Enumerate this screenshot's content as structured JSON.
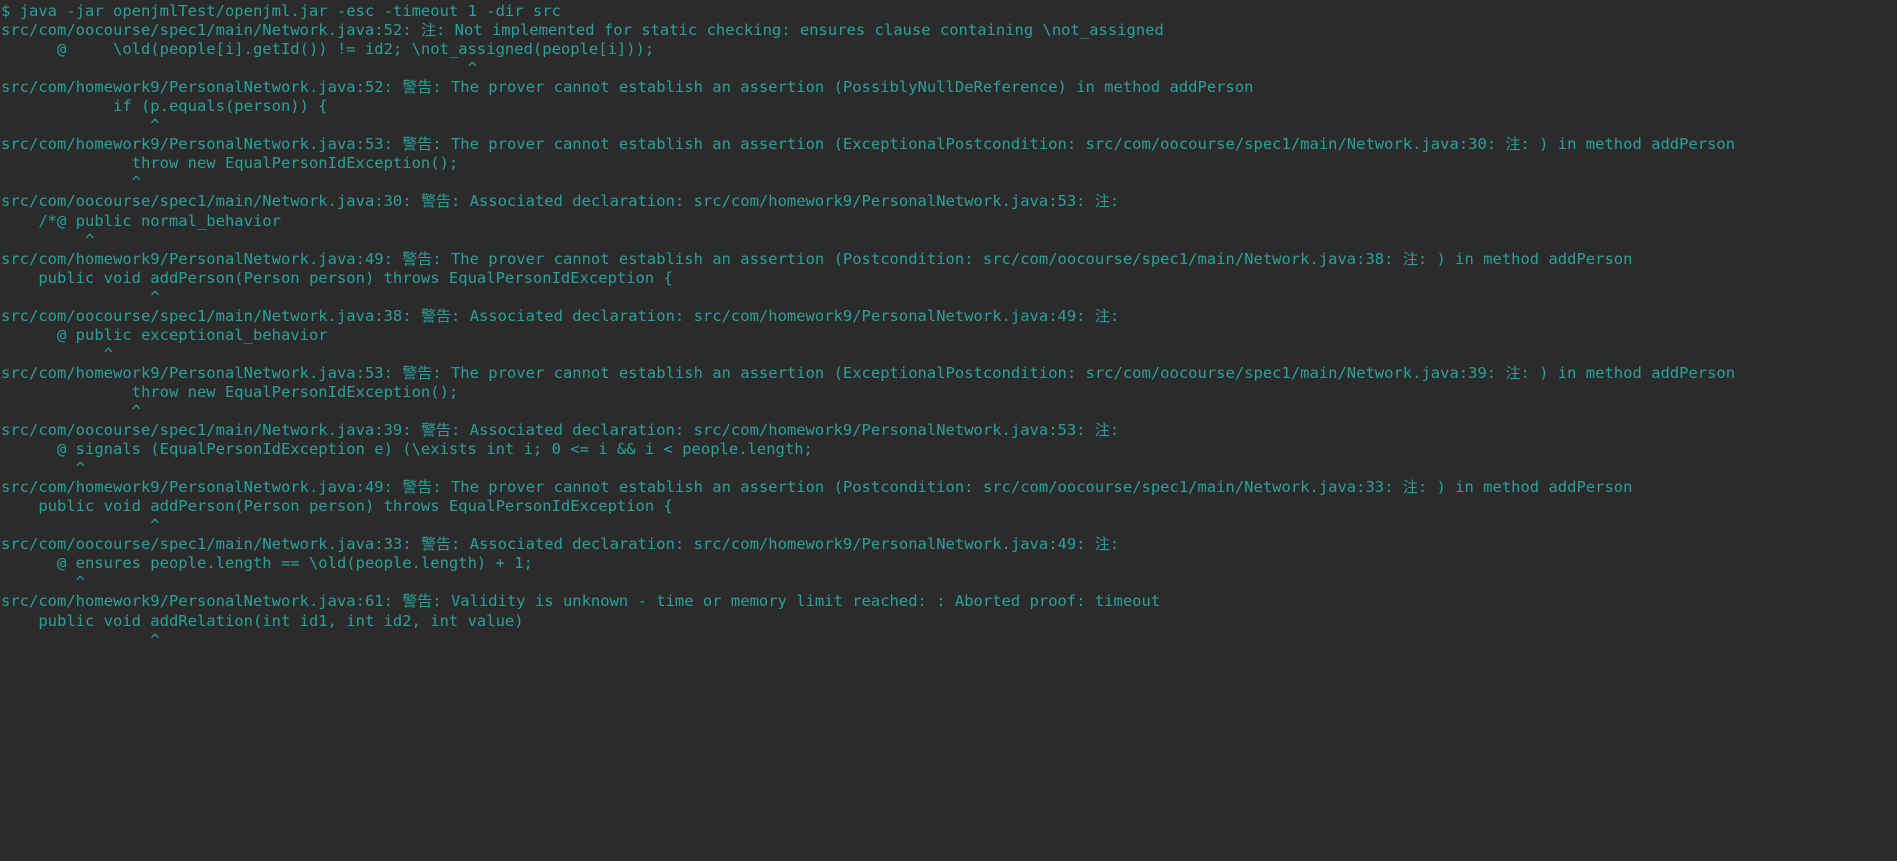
{
  "terminal": {
    "title": "Terminal",
    "colors": {
      "background": "#2b2b2b",
      "foreground": "#2aa198",
      "prompt": "#2aa198"
    },
    "prompt_symbol": "$",
    "command": "java -jar openjmlTest/openjml.jar -esc -timeout 1 -dir src",
    "lines": [
      {
        "id": "l0",
        "kind": "command",
        "text": "$ java -jar openjmlTest/openjml.jar -esc -timeout 1 -dir src"
      },
      {
        "id": "l1",
        "kind": "note",
        "text": "src/com/oocourse/spec1/main/Network.java:52: 注: Not implemented for static checking: ensures clause containing \\not_assigned"
      },
      {
        "id": "l2",
        "kind": "source",
        "text": "      @     \\old(people[i].getId()) != id2; \\not_assigned(people[i]));"
      },
      {
        "id": "l3",
        "kind": "caret",
        "text": "                                                  ^"
      },
      {
        "id": "l4",
        "kind": "warning",
        "text": "src/com/homework9/PersonalNetwork.java:52: 警告: The prover cannot establish an assertion (PossiblyNullDeReference) in method addPerson"
      },
      {
        "id": "l5",
        "kind": "source",
        "text": "            if (p.equals(person)) {"
      },
      {
        "id": "l6",
        "kind": "caret",
        "text": "                ^"
      },
      {
        "id": "l7",
        "kind": "warning",
        "text": "src/com/homework9/PersonalNetwork.java:53: 警告: The prover cannot establish an assertion (ExceptionalPostcondition: src/com/oocourse/spec1/main/Network.java:30: 注: ) in method addPerson"
      },
      {
        "id": "l8",
        "kind": "source",
        "text": "              throw new EqualPersonIdException();"
      },
      {
        "id": "l9",
        "kind": "caret",
        "text": "              ^"
      },
      {
        "id": "l10",
        "kind": "warning",
        "text": "src/com/oocourse/spec1/main/Network.java:30: 警告: Associated declaration: src/com/homework9/PersonalNetwork.java:53: 注: "
      },
      {
        "id": "l11",
        "kind": "source",
        "text": "    /*@ public normal_behavior"
      },
      {
        "id": "l12",
        "kind": "caret",
        "text": "         ^"
      },
      {
        "id": "l13",
        "kind": "warning",
        "text": "src/com/homework9/PersonalNetwork.java:49: 警告: The prover cannot establish an assertion (Postcondition: src/com/oocourse/spec1/main/Network.java:38: 注: ) in method addPerson"
      },
      {
        "id": "l14",
        "kind": "source",
        "text": "    public void addPerson(Person person) throws EqualPersonIdException {"
      },
      {
        "id": "l15",
        "kind": "caret",
        "text": "                ^"
      },
      {
        "id": "l16",
        "kind": "warning",
        "text": "src/com/oocourse/spec1/main/Network.java:38: 警告: Associated declaration: src/com/homework9/PersonalNetwork.java:49: 注: "
      },
      {
        "id": "l17",
        "kind": "source",
        "text": "      @ public exceptional_behavior"
      },
      {
        "id": "l18",
        "kind": "caret",
        "text": "           ^"
      },
      {
        "id": "l19",
        "kind": "warning",
        "text": "src/com/homework9/PersonalNetwork.java:53: 警告: The prover cannot establish an assertion (ExceptionalPostcondition: src/com/oocourse/spec1/main/Network.java:39: 注: ) in method addPerson"
      },
      {
        "id": "l20",
        "kind": "source",
        "text": "              throw new EqualPersonIdException();"
      },
      {
        "id": "l21",
        "kind": "caret",
        "text": "              ^"
      },
      {
        "id": "l22",
        "kind": "warning",
        "text": "src/com/oocourse/spec1/main/Network.java:39: 警告: Associated declaration: src/com/homework9/PersonalNetwork.java:53: 注: "
      },
      {
        "id": "l23",
        "kind": "source",
        "text": "      @ signals (EqualPersonIdException e) (\\exists int i; 0 <= i && i < people.length;"
      },
      {
        "id": "l24",
        "kind": "caret",
        "text": "        ^"
      },
      {
        "id": "l25",
        "kind": "warning",
        "text": "src/com/homework9/PersonalNetwork.java:49: 警告: The prover cannot establish an assertion (Postcondition: src/com/oocourse/spec1/main/Network.java:33: 注: ) in method addPerson"
      },
      {
        "id": "l26",
        "kind": "source",
        "text": "    public void addPerson(Person person) throws EqualPersonIdException {"
      },
      {
        "id": "l27",
        "kind": "caret",
        "text": "                ^"
      },
      {
        "id": "l28",
        "kind": "warning",
        "text": "src/com/oocourse/spec1/main/Network.java:33: 警告: Associated declaration: src/com/homework9/PersonalNetwork.java:49: 注: "
      },
      {
        "id": "l29",
        "kind": "source",
        "text": "      @ ensures people.length == \\old(people.length) + 1;"
      },
      {
        "id": "l30",
        "kind": "caret",
        "text": "        ^"
      },
      {
        "id": "l31",
        "kind": "warning",
        "text": "src/com/homework9/PersonalNetwork.java:61: 警告: Validity is unknown - time or memory limit reached: : Aborted proof: timeout"
      },
      {
        "id": "l32",
        "kind": "source",
        "text": "    public void addRelation(int id1, int id2, int value)"
      },
      {
        "id": "l33",
        "kind": "caret",
        "text": "                ^"
      }
    ]
  }
}
